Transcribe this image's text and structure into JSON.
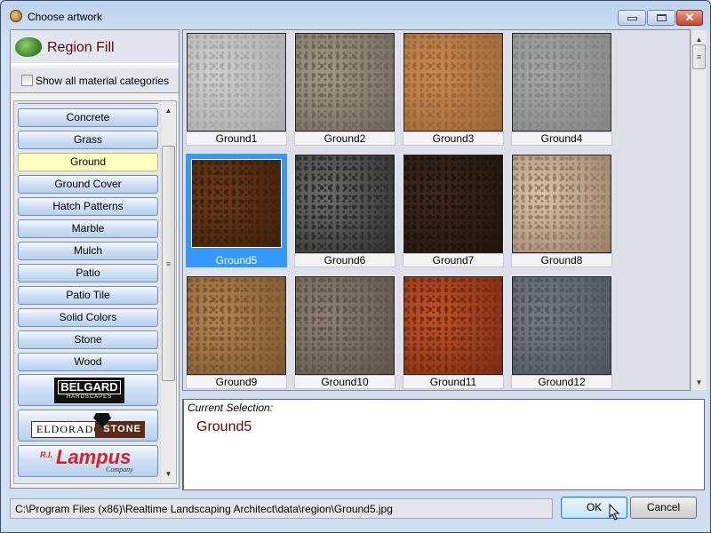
{
  "window": {
    "title": "Choose artwork",
    "icon": "app-icon",
    "controls": {
      "minimize": "minimize-icon",
      "maximize": "maximize-icon",
      "close": "✕"
    }
  },
  "left": {
    "header": "Region Fill",
    "show_all_label": "Show all material categories",
    "show_all_checked": false,
    "categories": [
      {
        "label": "Concrete",
        "selected": false
      },
      {
        "label": "Grass",
        "selected": false
      },
      {
        "label": "Ground",
        "selected": true
      },
      {
        "label": "Ground Cover",
        "selected": false
      },
      {
        "label": "Hatch Patterns",
        "selected": false
      },
      {
        "label": "Marble",
        "selected": false
      },
      {
        "label": "Mulch",
        "selected": false
      },
      {
        "label": "Patio",
        "selected": false
      },
      {
        "label": "Patio Tile",
        "selected": false
      },
      {
        "label": "Solid Colors",
        "selected": false
      },
      {
        "label": "Stone",
        "selected": false
      },
      {
        "label": "Wood",
        "selected": false
      }
    ],
    "brands": [
      {
        "logo": "BELGARD",
        "sub": "HARDSCAPES"
      },
      {
        "logo": "ELDORADO",
        "logo2": "STONE"
      },
      {
        "pre": "R.I.",
        "logo": "Lampus",
        "sub": "Company"
      }
    ]
  },
  "grid": {
    "items": [
      {
        "label": "Ground1",
        "color": "#cfcfcf",
        "color2": "#a9a9a9"
      },
      {
        "label": "Ground2",
        "color": "#a49a8a",
        "color2": "#6f665a"
      },
      {
        "label": "Ground3",
        "color": "#c78a55",
        "color2": "#9c6636"
      },
      {
        "label": "Ground4",
        "color": "#a5a7a6",
        "color2": "#858786"
      },
      {
        "label": "Ground5",
        "color": "#6b3a1a",
        "color2": "#3e200c"
      },
      {
        "label": "Ground6",
        "color": "#6c6c6a",
        "color2": "#2f2f2e"
      },
      {
        "label": "Ground7",
        "color": "#3d2a1c",
        "color2": "#1e140c"
      },
      {
        "label": "Ground8",
        "color": "#d9c3aa",
        "color2": "#9a7f68"
      },
      {
        "label": "Ground9",
        "color": "#b48553",
        "color2": "#7d5630"
      },
      {
        "label": "Ground10",
        "color": "#8d8174",
        "color2": "#5e554b"
      },
      {
        "label": "Ground11",
        "color": "#c0552a",
        "color2": "#7a2b12"
      },
      {
        "label": "Ground12",
        "color": "#767b80",
        "color2": "#4f5560"
      }
    ],
    "selected": "Ground5"
  },
  "current": {
    "label": "Current Selection:",
    "value": "Ground5"
  },
  "footer": {
    "path": "C:\\Program Files (x86)\\Realtime Landscaping Architect\\data\\region\\Ground5.jpg",
    "ok": "OK",
    "cancel": "Cancel"
  }
}
